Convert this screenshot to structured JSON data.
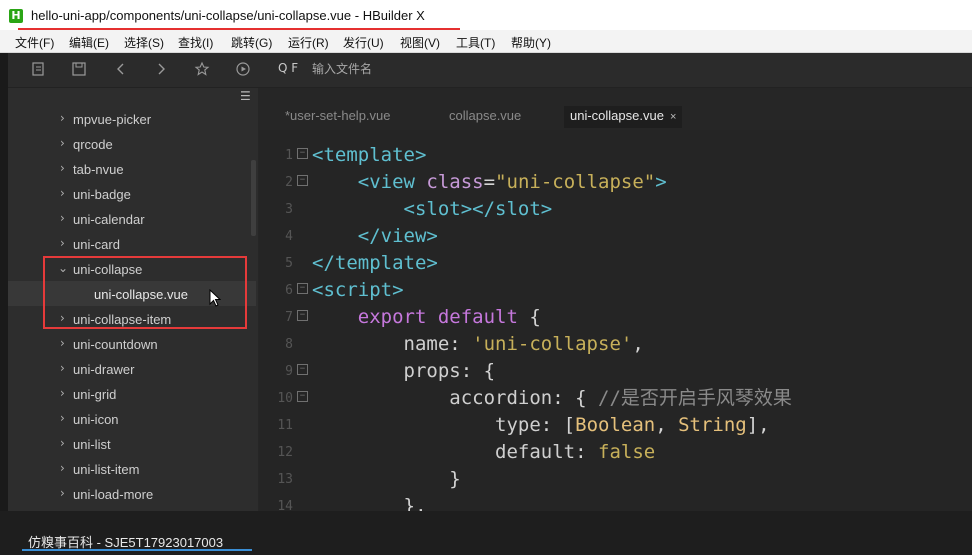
{
  "window": {
    "title": "hello-uni-app/components/uni-collapse/uni-collapse.vue - HBuilder X",
    "app_icon": "H"
  },
  "menubar": {
    "items": [
      "文件(F)",
      "编辑(E)",
      "选择(S)",
      "查找(I)",
      "跳转(G)",
      "运行(R)",
      "发行(U)",
      "视图(V)",
      "工具(T)",
      "帮助(Y)"
    ]
  },
  "toolbar": {
    "icons": [
      "new-file-icon",
      "save-icon",
      "back-icon",
      "forward-icon",
      "star-icon",
      "run-icon"
    ],
    "search_prefix": "Q F",
    "search_placeholder": "输入文件名"
  },
  "sidebar": {
    "items": [
      {
        "label": "mpvue-picker",
        "expanded": false
      },
      {
        "label": "qrcode",
        "expanded": false
      },
      {
        "label": "tab-nvue",
        "expanded": false
      },
      {
        "label": "uni-badge",
        "expanded": false
      },
      {
        "label": "uni-calendar",
        "expanded": false
      },
      {
        "label": "uni-card",
        "expanded": false
      },
      {
        "label": "uni-collapse",
        "expanded": true
      },
      {
        "label": "uni-collapse.vue",
        "file": true,
        "selected": true
      },
      {
        "label": "uni-collapse-item",
        "expanded": false
      },
      {
        "label": "uni-countdown",
        "expanded": false
      },
      {
        "label": "uni-drawer",
        "expanded": false
      },
      {
        "label": "uni-grid",
        "expanded": false
      },
      {
        "label": "uni-icon",
        "expanded": false
      },
      {
        "label": "uni-list",
        "expanded": false
      },
      {
        "label": "uni-list-item",
        "expanded": false
      },
      {
        "label": "uni-load-more",
        "expanded": false
      }
    ]
  },
  "tabs": [
    {
      "label": "*user-set-help.vue",
      "active": false
    },
    {
      "label": "collapse.vue",
      "active": false
    },
    {
      "label": "uni-collapse.vue",
      "active": true,
      "close": "×"
    }
  ],
  "editor": {
    "lines": [
      {
        "n": "1",
        "fold": "−"
      },
      {
        "n": "2",
        "fold": "−"
      },
      {
        "n": "3"
      },
      {
        "n": "4"
      },
      {
        "n": "5"
      },
      {
        "n": "6",
        "fold": "−"
      },
      {
        "n": "7",
        "fold": "−"
      },
      {
        "n": "8"
      },
      {
        "n": "9",
        "fold": "−"
      },
      {
        "n": "10",
        "fold": "−"
      },
      {
        "n": "11"
      },
      {
        "n": "12"
      },
      {
        "n": "13"
      },
      {
        "n": "14"
      }
    ],
    "tokens": {
      "l1_open": "<template>",
      "l2_view": "<view ",
      "l2_attr": "class",
      "l2_eq": "=",
      "l2_val": "\"uni-collapse\"",
      "l2_close": ">",
      "l3": "<slot></slot>",
      "l4": "</view>",
      "l5": "</template>",
      "l6": "<script>",
      "l7_kw": "export default",
      "l7_brace": " {",
      "l8_key": "name",
      "l8_colon": ": ",
      "l8_val": "'uni-collapse'",
      "l8_comma": ",",
      "l9_key": "props",
      "l9_rest": ": {",
      "l10_key": "accordion",
      "l10_rest": ": { ",
      "l10_comment": "//是否开启手风琴效果",
      "l11_key": "type",
      "l11_colon": ": [",
      "l11_t1": "Boolean",
      "l11_sep": ", ",
      "l11_t2": "String",
      "l11_end": "],",
      "l12_key": "default",
      "l12_colon": ": ",
      "l12_val": "false",
      "l13": "}",
      "l14": "},"
    }
  },
  "status": {
    "text": "仿糗事百科 - SJE5T17923017003"
  },
  "colors": {
    "accent_red": "#e53a3a",
    "status_underline": "#3a8fd6"
  }
}
